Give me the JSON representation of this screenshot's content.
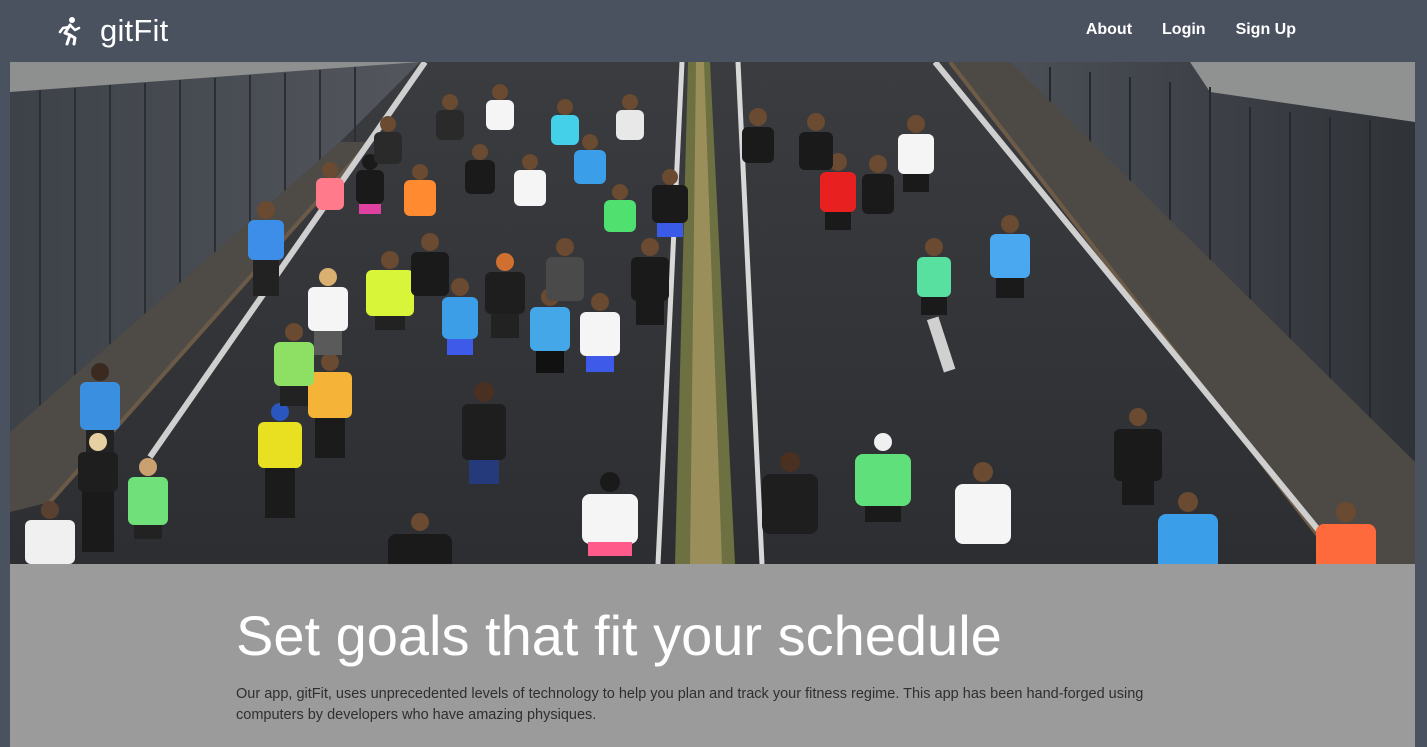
{
  "brand": {
    "name": "gitFit",
    "icon": "running-person-icon"
  },
  "nav": {
    "links": [
      {
        "label": "About"
      },
      {
        "label": "Login"
      },
      {
        "label": "Sign Up"
      }
    ]
  },
  "hero": {
    "image_subject": "marathon runners on a road between two walls"
  },
  "main": {
    "headline": "Set goals that fit your schedule",
    "description": "Our app, gitFit, uses unprecedented levels of technology to help you plan and track your fitness regime. This app has been hand-forged using computers by developers who have amazing physiques."
  },
  "colors": {
    "navbar": "#4a5260",
    "content_panel": "#9b9b9b",
    "headline": "#ffffff",
    "body_text": "#2f2f2f"
  }
}
